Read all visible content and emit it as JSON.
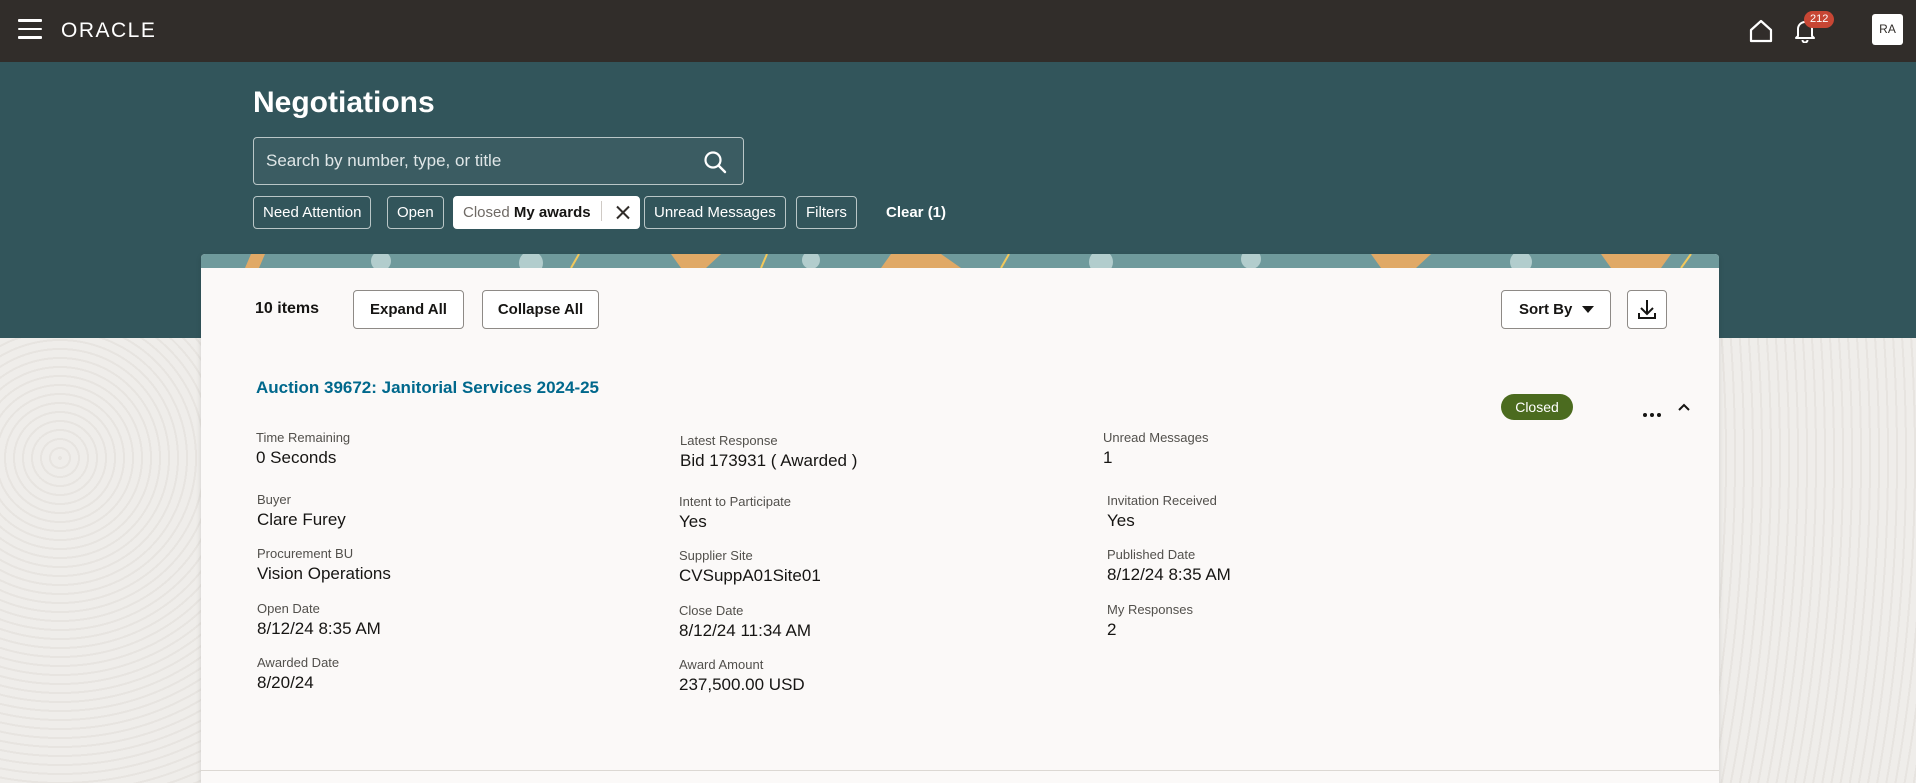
{
  "header": {
    "logo": "ORACLE",
    "notifications_count": "212",
    "avatar_initials": "RA"
  },
  "page": {
    "title": "Negotiations",
    "search_placeholder": "Search by number, type, or title"
  },
  "filters": {
    "need_attention": "Need Attention",
    "open": "Open",
    "closed_prefix": "Closed",
    "closed_value": "My awards",
    "unread_messages": "Unread Messages",
    "filters": "Filters",
    "clear": "Clear (1)"
  },
  "toolbar": {
    "items_count": "10 items",
    "expand_all": "Expand All",
    "collapse_all": "Collapse All",
    "sort_by": "Sort By"
  },
  "negotiation": {
    "title": "Auction 39672: Janitorial Services 2024-25",
    "status": "Closed",
    "fields": {
      "time_remaining": {
        "label": "Time Remaining",
        "value": "0 Seconds"
      },
      "latest_response": {
        "label": "Latest Response",
        "value": "Bid 173931 ( Awarded )"
      },
      "unread_messages": {
        "label": "Unread Messages",
        "value": "1"
      },
      "buyer": {
        "label": "Buyer",
        "value": "Clare Furey"
      },
      "intent": {
        "label": "Intent to Participate",
        "value": "Yes"
      },
      "invitation": {
        "label": "Invitation Received",
        "value": "Yes"
      },
      "procurement_bu": {
        "label": "Procurement BU",
        "value": "Vision Operations"
      },
      "supplier_site": {
        "label": "Supplier Site",
        "value": "CVSuppA01Site01"
      },
      "published_date": {
        "label": "Published Date",
        "value": "8/12/24 8:35 AM"
      },
      "open_date": {
        "label": "Open Date",
        "value": "8/12/24 8:35 AM"
      },
      "close_date": {
        "label": "Close Date",
        "value": "8/12/24 11:34 AM"
      },
      "my_responses": {
        "label": "My Responses",
        "value": "2"
      },
      "awarded_date": {
        "label": "Awarded Date",
        "value": "8/20/24"
      },
      "award_amount": {
        "label": "Award Amount",
        "value": "237,500.00 USD"
      }
    }
  },
  "colors": {
    "topbar": "#312d2a",
    "hero": "#32555b",
    "link": "#00688c",
    "status_closed": "#4b6b1f",
    "badge": "#c74634"
  }
}
